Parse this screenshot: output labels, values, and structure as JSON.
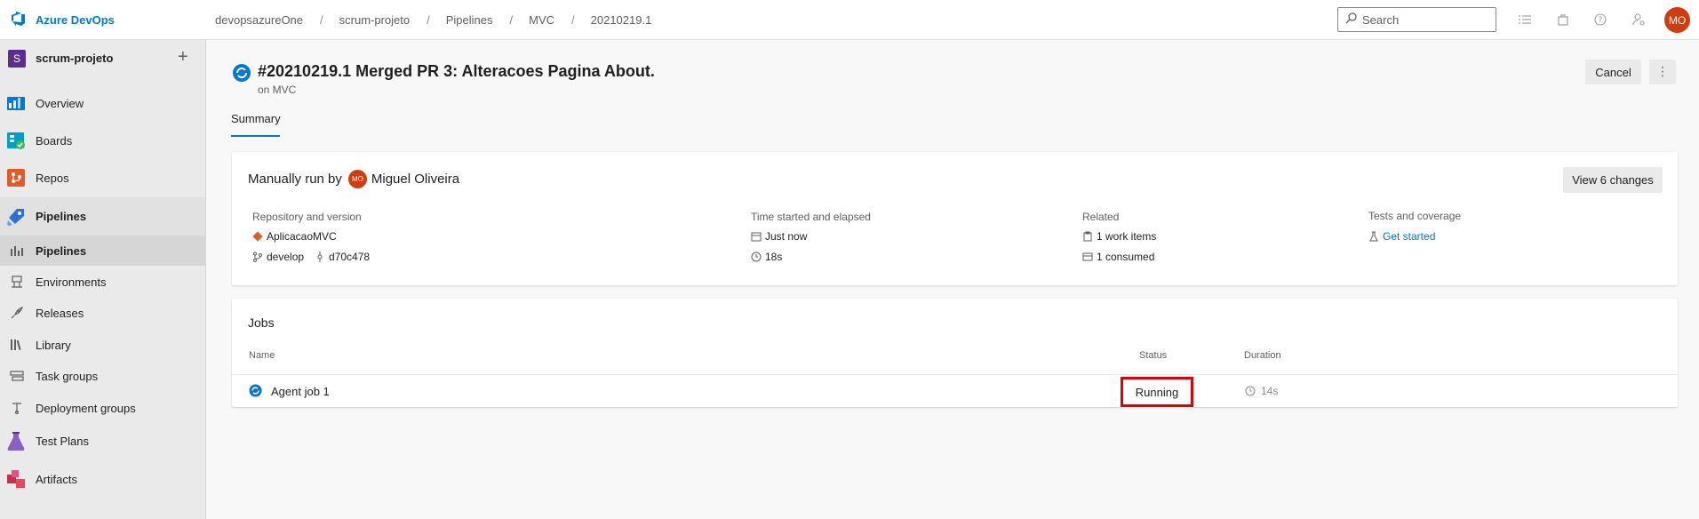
{
  "app": {
    "brand": "Azure DevOps"
  },
  "breadcrumb": [
    "devopsazureOne",
    "scrum-projeto",
    "Pipelines",
    "MVC",
    "20210219.1"
  ],
  "search": {
    "placeholder": "Search"
  },
  "user": {
    "initials": "MO"
  },
  "project": {
    "badge": "S",
    "name": "scrum-projeto"
  },
  "sidebar": {
    "items": [
      {
        "label": "Overview"
      },
      {
        "label": "Boards"
      },
      {
        "label": "Repos"
      },
      {
        "label": "Pipelines"
      },
      {
        "label": "Pipelines"
      },
      {
        "label": "Environments"
      },
      {
        "label": "Releases"
      },
      {
        "label": "Library"
      },
      {
        "label": "Task groups"
      },
      {
        "label": "Deployment groups"
      },
      {
        "label": "Test Plans"
      },
      {
        "label": "Artifacts"
      }
    ]
  },
  "run": {
    "title": "#20210219.1 Merged PR 3: Alteracoes Pagina About.",
    "subtitle": "on MVC",
    "cancel_label": "Cancel",
    "more_label": "⋮",
    "tab": "Summary"
  },
  "summary": {
    "manual_prefix": "Manually run by",
    "user_initials": "MO",
    "user_name": "Miguel Oliveira",
    "view_changes": "View 6 changes",
    "repo_label": "Repository and version",
    "repo_name": "AplicacaoMVC",
    "branch": "develop",
    "commit": "d70c478",
    "time_label": "Time started and elapsed",
    "started": "Just now",
    "elapsed": "18s",
    "related_label": "Related",
    "work_items": "1 work items",
    "consumed": "1 consumed",
    "tests_label": "Tests and coverage",
    "tests_link": "Get started"
  },
  "jobs": {
    "title": "Jobs",
    "columns": [
      "Name",
      "Status",
      "Duration"
    ],
    "rows": [
      {
        "name": "Agent job 1",
        "status": "Running",
        "duration": "14s"
      }
    ]
  },
  "colors": {
    "accent": "#0078d4",
    "avatar": "#d13b0e",
    "highlight": "#e00000",
    "project": "#5c2d91"
  }
}
